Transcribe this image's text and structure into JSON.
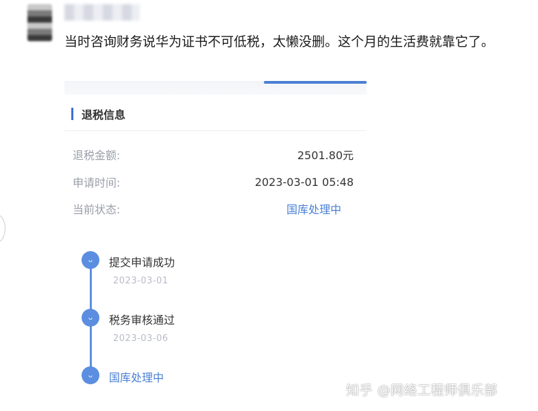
{
  "post": {
    "comment_text": "当时咨询财务说华为证书不可低税，太懒没删。这个月的生活费就靠它了。"
  },
  "card": {
    "section_title": "退税信息",
    "rows": [
      {
        "label": "退税金额:",
        "value": "2501.80元"
      },
      {
        "label": "申请时间:",
        "value": "2023-03-01 05:48"
      },
      {
        "label": "当前状态:",
        "value": "国库处理中"
      }
    ],
    "timeline": [
      {
        "title": "提交申请成功",
        "date": "2023-03-01"
      },
      {
        "title": "税务审核通过",
        "date": "2023-03-06"
      },
      {
        "title": "国库处理中",
        "date": ""
      }
    ]
  },
  "watermark": "知乎 @网络工程师俱乐部",
  "colors": {
    "accent": "#4a7fd4",
    "label": "#9a9ea8",
    "timeline": "#5b8ee0"
  }
}
